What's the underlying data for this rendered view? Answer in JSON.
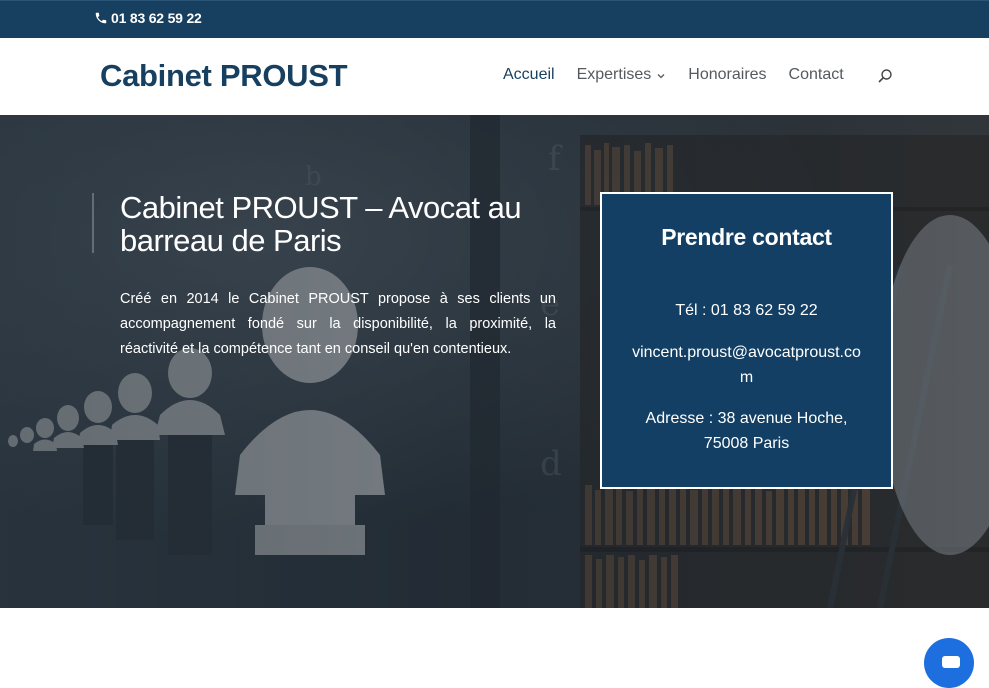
{
  "topbar": {
    "phone_icon": "phone-icon",
    "phone": "01 83 62 59 22"
  },
  "header": {
    "logo": "Cabinet PROUST",
    "nav": [
      {
        "label": "Accueil",
        "active": true
      },
      {
        "label": "Expertises",
        "has_dropdown": true
      },
      {
        "label": "Honoraires"
      },
      {
        "label": "Contact"
      }
    ],
    "search_icon": "search-icon"
  },
  "hero": {
    "title": "Cabinet PROUST – Avocat au barreau de Paris",
    "text": "Créé en 2014 le Cabinet PROUST propose à ses clients un accompagnement fondé sur la disponibilité, la proximité, la réactivité et la compétence tant en conseil qu'en contentieux."
  },
  "contact_box": {
    "title": "Prendre contact",
    "tel": "Tél : 01 83 62 59 22",
    "email": "vincent.proust@avocatproust.com",
    "address": "Adresse : 38 avenue Hoche, 75008 Paris"
  },
  "chat": {
    "icon": "chat-icon"
  },
  "colors": {
    "brand": "#173f5f",
    "contact_box": "#123f63",
    "chat": "#1d6fe0"
  }
}
